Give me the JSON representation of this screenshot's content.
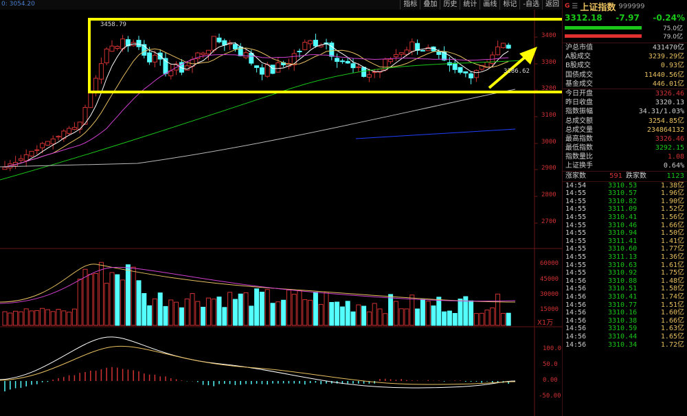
{
  "toolbar": [
    {
      "label": "指标"
    },
    {
      "label": "叠加"
    },
    {
      "label": "历史"
    },
    {
      "label": "统计"
    },
    {
      "label": "画线"
    },
    {
      "label": "标记"
    },
    {
      "label": "-自选"
    },
    {
      "label": "返回"
    }
  ],
  "readout": "0: 3054.20",
  "price_axis": [
    "3400",
    "3300",
    "3200",
    "3100",
    "3000",
    "2900",
    "2800",
    "2700"
  ],
  "volume_axis": [
    "60000",
    "45000",
    "30000",
    "15000"
  ],
  "volume_unit": "X1万",
  "macd_axis": [
    "100.0",
    "50.0",
    "0.00",
    "-50.00"
  ],
  "annotations": {
    "high": "3458.79",
    "low": "3286.62"
  },
  "colors": {
    "up": "#d23232",
    "down": "#54ffff",
    "green_text": "#19c819",
    "yellow": "#ffff00",
    "ma5": "#ffffff",
    "ma10": "#e8c060",
    "ma20": "#d040d0",
    "ma60": "#19c819",
    "ma120": "#bbbbbb",
    "ma250": "#2040ff"
  },
  "panel": {
    "g_mark": "G",
    "menu_icon": "menu-icon",
    "name": "上证指数",
    "code": "999999",
    "price": "3312.18",
    "change": "-7.97",
    "pct": "-0.24%",
    "bar1_pct": "75.0亿",
    "bar2_pct": "79.0亿",
    "rows_a": [
      {
        "label": "沪总市值",
        "value": "431470亿",
        "color": "#d0d0d0"
      },
      {
        "label": "A股成交",
        "value": "3239.29亿",
        "color": "#e8c060"
      },
      {
        "label": "B股成交",
        "value": "0.93亿",
        "color": "#e8c060"
      },
      {
        "label": "国债成交",
        "value": "11440.56亿",
        "color": "#e8c060"
      },
      {
        "label": "基金成交",
        "value": "446.01亿",
        "color": "#e8c060"
      }
    ],
    "rows_b": [
      {
        "label": "今日开盘",
        "value": "3326.46",
        "color": "#d23232"
      },
      {
        "label": "昨日收盘",
        "value": "3320.13",
        "color": "#d0d0d0"
      },
      {
        "label": "指数振幅",
        "value": "34.31/1.03%",
        "color": "#d0d0d0"
      },
      {
        "label": "总成交额",
        "value": "3254.85亿",
        "color": "#e8c060"
      },
      {
        "label": "总成交量",
        "value": "234864132",
        "color": "#e8c060"
      },
      {
        "label": "最高指数",
        "value": "3326.46",
        "color": "#d23232"
      },
      {
        "label": "最低指数",
        "value": "3292.15",
        "color": "#19c819"
      },
      {
        "label": "指数量比",
        "value": "1.08",
        "color": "#d23232"
      },
      {
        "label": "上证换手",
        "value": "0.64%",
        "color": "#d0d0d0"
      }
    ],
    "up_label": "涨家数",
    "up_count": "591",
    "down_label": "跌家数",
    "down_count": "1123",
    "ticks": [
      {
        "time": "14:54",
        "price": "3310.53",
        "amount": "1.38亿"
      },
      {
        "time": "14:55",
        "price": "3310.57",
        "amount": "1.96亿"
      },
      {
        "time": "14:55",
        "price": "3310.82",
        "amount": "1.90亿"
      },
      {
        "time": "14:55",
        "price": "3311.09",
        "amount": "1.52亿"
      },
      {
        "time": "14:55",
        "price": "3310.41",
        "amount": "1.56亿"
      },
      {
        "time": "14:55",
        "price": "3310.46",
        "amount": "1.66亿"
      },
      {
        "time": "14:55",
        "price": "3310.94",
        "amount": "1.50亿"
      },
      {
        "time": "14:55",
        "price": "3311.41",
        "amount": "1.41亿"
      },
      {
        "time": "14:55",
        "price": "3310.60",
        "amount": "1.77亿"
      },
      {
        "time": "14:55",
        "price": "3311.13",
        "amount": "1.36亿"
      },
      {
        "time": "14:55",
        "price": "3310.63",
        "amount": "1.61亿"
      },
      {
        "time": "14:55",
        "price": "3310.92",
        "amount": "1.75亿"
      },
      {
        "time": "14:56",
        "price": "3310.88",
        "amount": "1.48亿"
      },
      {
        "time": "14:56",
        "price": "3310.51",
        "amount": "1.58亿"
      },
      {
        "time": "14:56",
        "price": "3310.41",
        "amount": "1.74亿"
      },
      {
        "time": "14:56",
        "price": "3310.77",
        "amount": "1.51亿"
      },
      {
        "time": "14:56",
        "price": "3310.16",
        "amount": "1.60亿"
      },
      {
        "time": "14:56",
        "price": "3310.38",
        "amount": "1.66亿"
      },
      {
        "time": "14:56",
        "price": "3310.59",
        "amount": "1.63亿"
      },
      {
        "time": "14:56",
        "price": "3310.44",
        "amount": "1.65亿"
      },
      {
        "time": "14:56",
        "price": "3310.34",
        "amount": "1.72亿"
      }
    ]
  }
}
